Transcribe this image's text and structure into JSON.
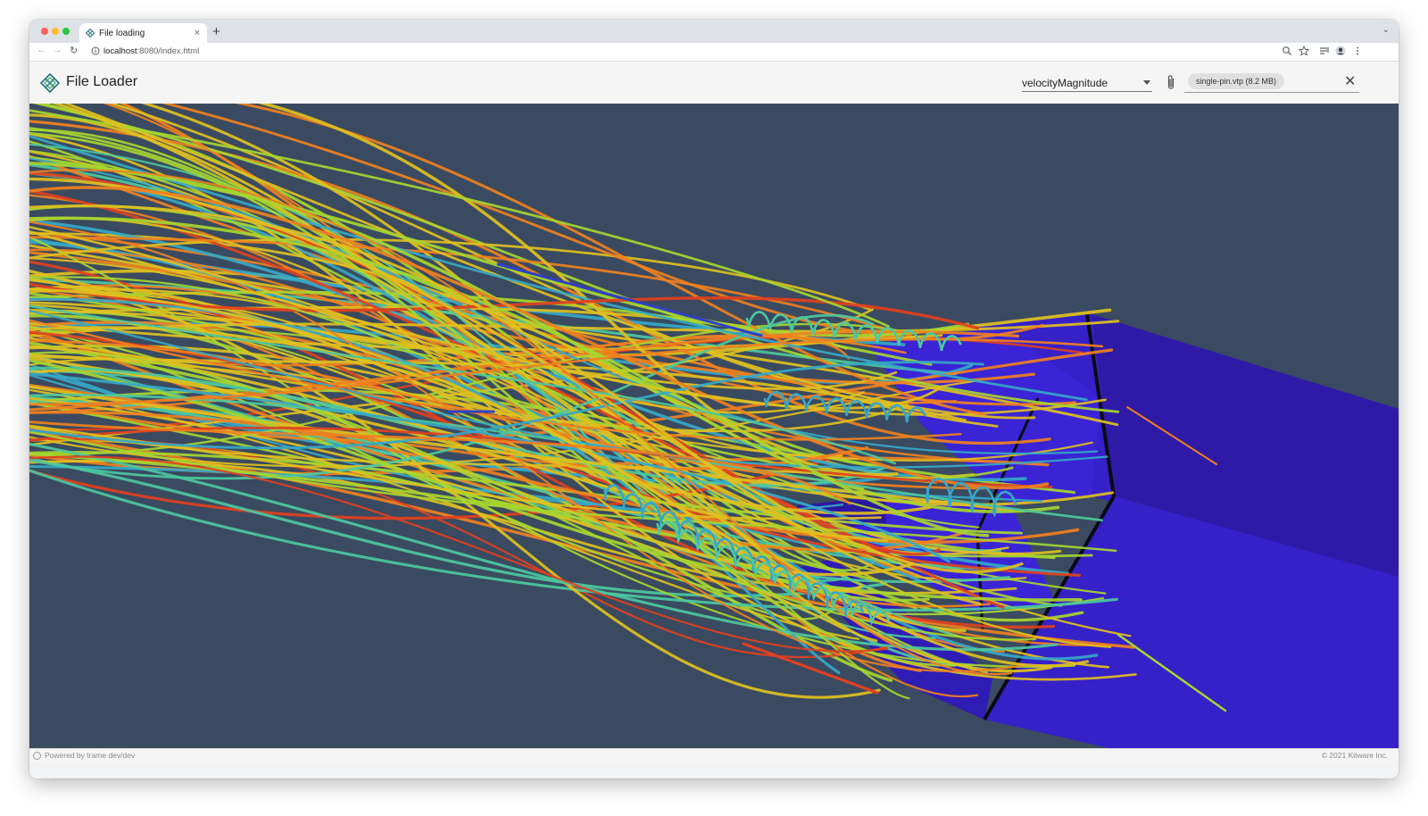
{
  "browser": {
    "tab_title": "File loading",
    "tab_close": "×",
    "new_tab": "+",
    "tab_menu": "⌄",
    "url_host": "localhost",
    "url_rest": ":8080/index.html",
    "nav_back": "←",
    "nav_forward": "→",
    "nav_reload": "↻"
  },
  "app": {
    "title": "File Loader",
    "array_select_value": "velocityMagnitude",
    "file_chip": "single-pin.vtp (8.2 MB)",
    "close_label": "✕"
  },
  "viewer": {
    "background": "#3a4a60",
    "geometry_color": "#3a2ad0",
    "colormap": [
      "#3040c8",
      "#35a8c8",
      "#4cc8a0",
      "#a6d630",
      "#e0c020",
      "#f08020",
      "#e04020"
    ]
  },
  "footer": {
    "powered_by": "Powered by trame dev/dev",
    "copyright": "© 2021 Kitware Inc."
  }
}
